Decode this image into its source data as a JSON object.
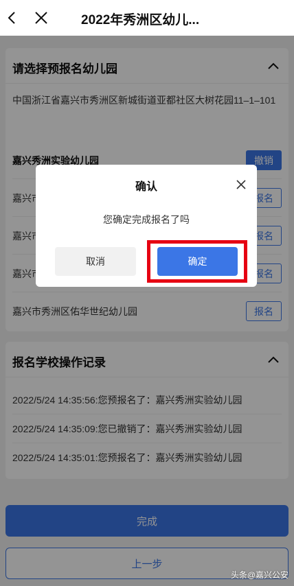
{
  "nav": {
    "title": "2022年秀洲区幼儿..."
  },
  "select_card": {
    "heading": "请选择预报名幼儿园",
    "address": "中国浙江省嘉兴市秀洲区新城街道亚都社区大树花园11–1–101",
    "kindergartens": [
      {
        "name": "嘉兴秀洲实验幼儿园",
        "action": "撤销"
      },
      {
        "name": "嘉兴市",
        "action": "报名"
      },
      {
        "name": "嘉兴市",
        "action": "报名"
      },
      {
        "name": "嘉兴市",
        "action": "报名"
      },
      {
        "name": "嘉兴市秀洲区佑华世纪幼儿园",
        "action": "报名"
      }
    ]
  },
  "log_card": {
    "heading": "报名学校操作记录",
    "entries": [
      "2022/5/24 14:35:56:您预报名了：嘉兴秀洲实验幼儿园",
      "2022/5/24 14:35:09:您已撤销了：嘉兴秀洲实验幼儿园",
      "2022/5/24 14:35:01:您预报名了：嘉兴秀洲实验幼儿园"
    ]
  },
  "footer": {
    "done_label": "完成",
    "prev_label": "上一步"
  },
  "dialog": {
    "title": "确认",
    "message": "您确定完成报名了吗",
    "cancel_label": "取消",
    "ok_label": "确定"
  },
  "watermark": "头条@嘉兴公安",
  "colors": {
    "accent": "#3b76e6",
    "highlight": "#e60012"
  }
}
